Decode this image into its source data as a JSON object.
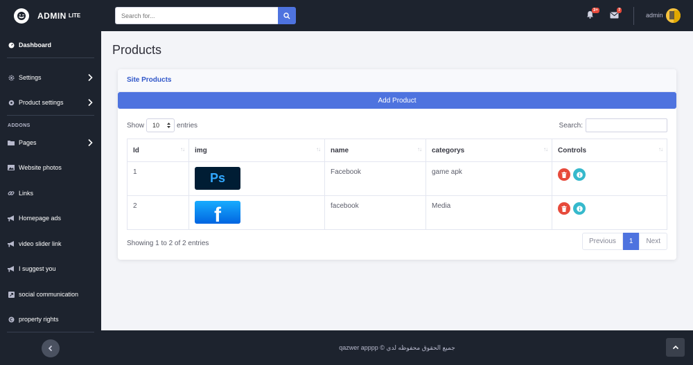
{
  "brand": {
    "name": "ADMIN",
    "suffix": "LITE"
  },
  "topbar": {
    "search_placeholder": "Search for...",
    "alerts_badge": "3+",
    "messages_badge": "7",
    "user_name": "admin"
  },
  "sidebar": {
    "dashboard": "Dashboard",
    "settings": "Settings",
    "product_settings": "Product settings",
    "addons_heading": "ADDONS",
    "pages": "Pages",
    "website_photos": "Website photos",
    "links": "Links",
    "homepage_ads": "Homepage ads",
    "video_slider_link": "video slider link",
    "i_suggest_you": "I suggest you",
    "social_communication": "social communication",
    "property_rights": "property rights"
  },
  "main": {
    "page_title": "Products",
    "card_title": "Site Products",
    "add_button": "Add Product",
    "show_label": "Show",
    "entries_value": "10",
    "entries_label": "entries",
    "search_label": "Search:",
    "columns": [
      "Id",
      "img",
      "name",
      "categorys",
      "Controls"
    ],
    "rows": [
      {
        "id": "1",
        "img": "Ps",
        "name": "Facebook",
        "category": "game apk"
      },
      {
        "id": "2",
        "img": "f",
        "name": "facebook",
        "category": "Media"
      }
    ],
    "info": "Showing 1 to 2 of 2 entries",
    "pager": {
      "prev": "Previous",
      "page": "1",
      "next": "Next"
    }
  },
  "footer": {
    "text": "qazwer apppp © جميع الحقوق محفوظه لدي"
  },
  "colors": {
    "primary": "#4e73df",
    "dark": "#1d232e",
    "danger": "#e74a3b",
    "info": "#36b9cc"
  }
}
